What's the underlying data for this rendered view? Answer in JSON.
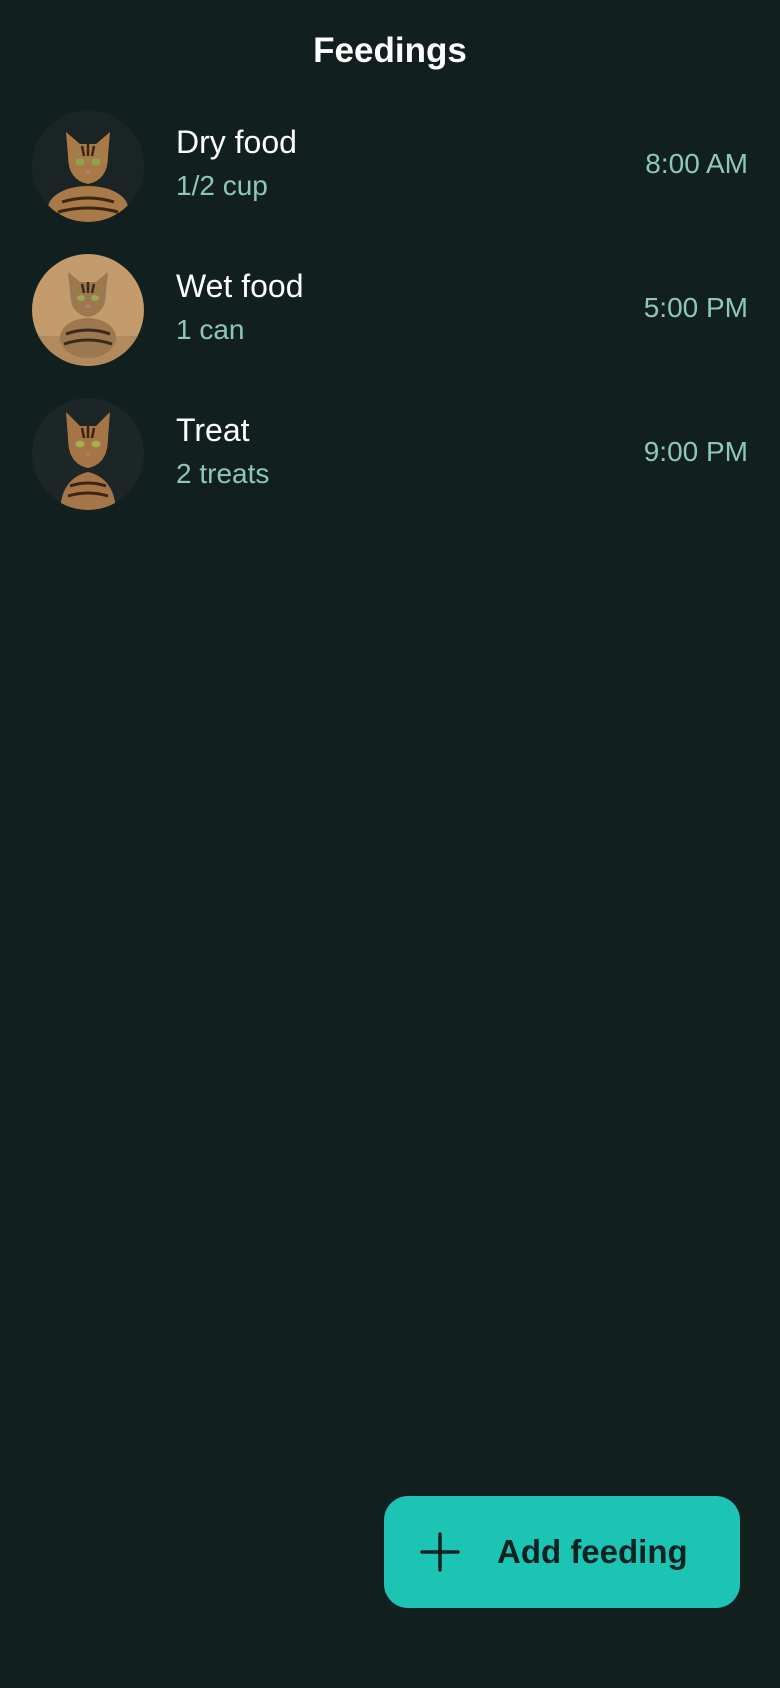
{
  "header": {
    "title": "Feedings"
  },
  "feedings": [
    {
      "title": "Dry food",
      "amount": "1/2 cup",
      "time": "8:00 AM",
      "avatar": {
        "icon": "tabby-cat-photo",
        "background": "#1a2424",
        "fur": "#a87a48",
        "stripe": "#3a2612",
        "eyes": "#8fa54a"
      }
    },
    {
      "title": "Wet food",
      "amount": "1 can",
      "time": "5:00 PM",
      "avatar": {
        "icon": "tabby-cat-photo",
        "background": "#c49b6c",
        "fur": "#9c7850",
        "stripe": "#3d2a18",
        "eyes": "#9aa84e"
      }
    },
    {
      "title": "Treat",
      "amount": "2 treats",
      "time": "9:00 PM",
      "avatar": {
        "icon": "tabby-cat-photo",
        "background": "#1c2626",
        "fur": "#a57548",
        "stripe": "#3a2412",
        "eyes": "#a3b04c"
      }
    }
  ],
  "fab": {
    "label": "Add feeding",
    "icon": "plus-icon"
  },
  "colors": {
    "background": "#121f1f",
    "title_text": "#ffffff",
    "secondary_text": "#8fc7b6",
    "accent": "#1cc5b3",
    "on_accent": "#0f2222"
  }
}
